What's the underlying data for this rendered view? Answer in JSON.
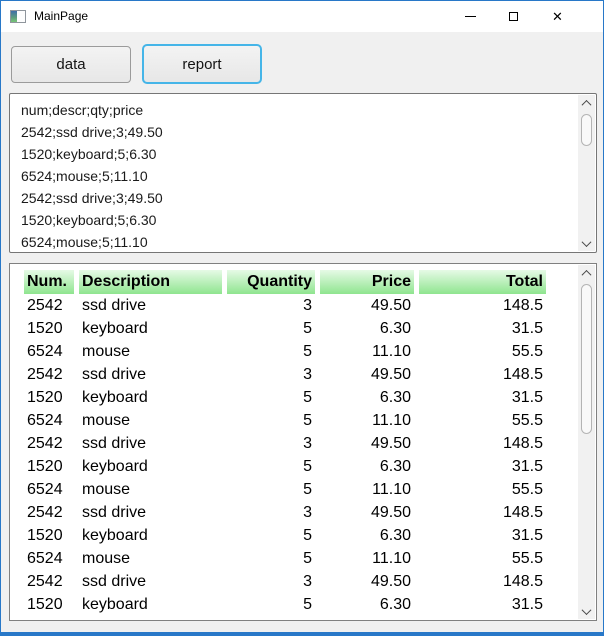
{
  "window": {
    "title": "MainPage",
    "close_glyph": "✕"
  },
  "toolbar": {
    "data_label": "data",
    "report_label": "report"
  },
  "csv_editor": {
    "lines": [
      "num;descr;qty;price",
      "2542;ssd drive;3;49.50",
      "1520;keyboard;5;6.30",
      "6524;mouse;5;11.10",
      "2542;ssd drive;3;49.50",
      "1520;keyboard;5;6.30",
      "6524;mouse;5;11.10"
    ]
  },
  "report_table": {
    "columns": [
      {
        "label": "Num.",
        "align": "left"
      },
      {
        "label": "Description",
        "align": "left"
      },
      {
        "label": "Quantity",
        "align": "right"
      },
      {
        "label": "Price",
        "align": "right"
      },
      {
        "label": "Total",
        "align": "right"
      }
    ],
    "rows": [
      [
        "2542",
        "ssd drive",
        "3",
        "49.50",
        "148.5"
      ],
      [
        "1520",
        "keyboard",
        "5",
        "6.30",
        "31.5"
      ],
      [
        "6524",
        "mouse",
        "5",
        "11.10",
        "55.5"
      ],
      [
        "2542",
        "ssd drive",
        "3",
        "49.50",
        "148.5"
      ],
      [
        "1520",
        "keyboard",
        "5",
        "6.30",
        "31.5"
      ],
      [
        "6524",
        "mouse",
        "5",
        "11.10",
        "55.5"
      ],
      [
        "2542",
        "ssd drive",
        "3",
        "49.50",
        "148.5"
      ],
      [
        "1520",
        "keyboard",
        "5",
        "6.30",
        "31.5"
      ],
      [
        "6524",
        "mouse",
        "5",
        "11.10",
        "55.5"
      ],
      [
        "2542",
        "ssd drive",
        "3",
        "49.50",
        "148.5"
      ],
      [
        "1520",
        "keyboard",
        "5",
        "6.30",
        "31.5"
      ],
      [
        "6524",
        "mouse",
        "5",
        "11.10",
        "55.5"
      ],
      [
        "2542",
        "ssd drive",
        "3",
        "49.50",
        "148.5"
      ],
      [
        "1520",
        "keyboard",
        "5",
        "6.30",
        "31.5"
      ]
    ]
  },
  "colors": {
    "accent_border": "#2878c8",
    "focus_ring": "#45b5e8",
    "header_gradient_top": "#e6fae6",
    "header_gradient_bottom": "#8fe58f",
    "panel_border": "#767676"
  }
}
